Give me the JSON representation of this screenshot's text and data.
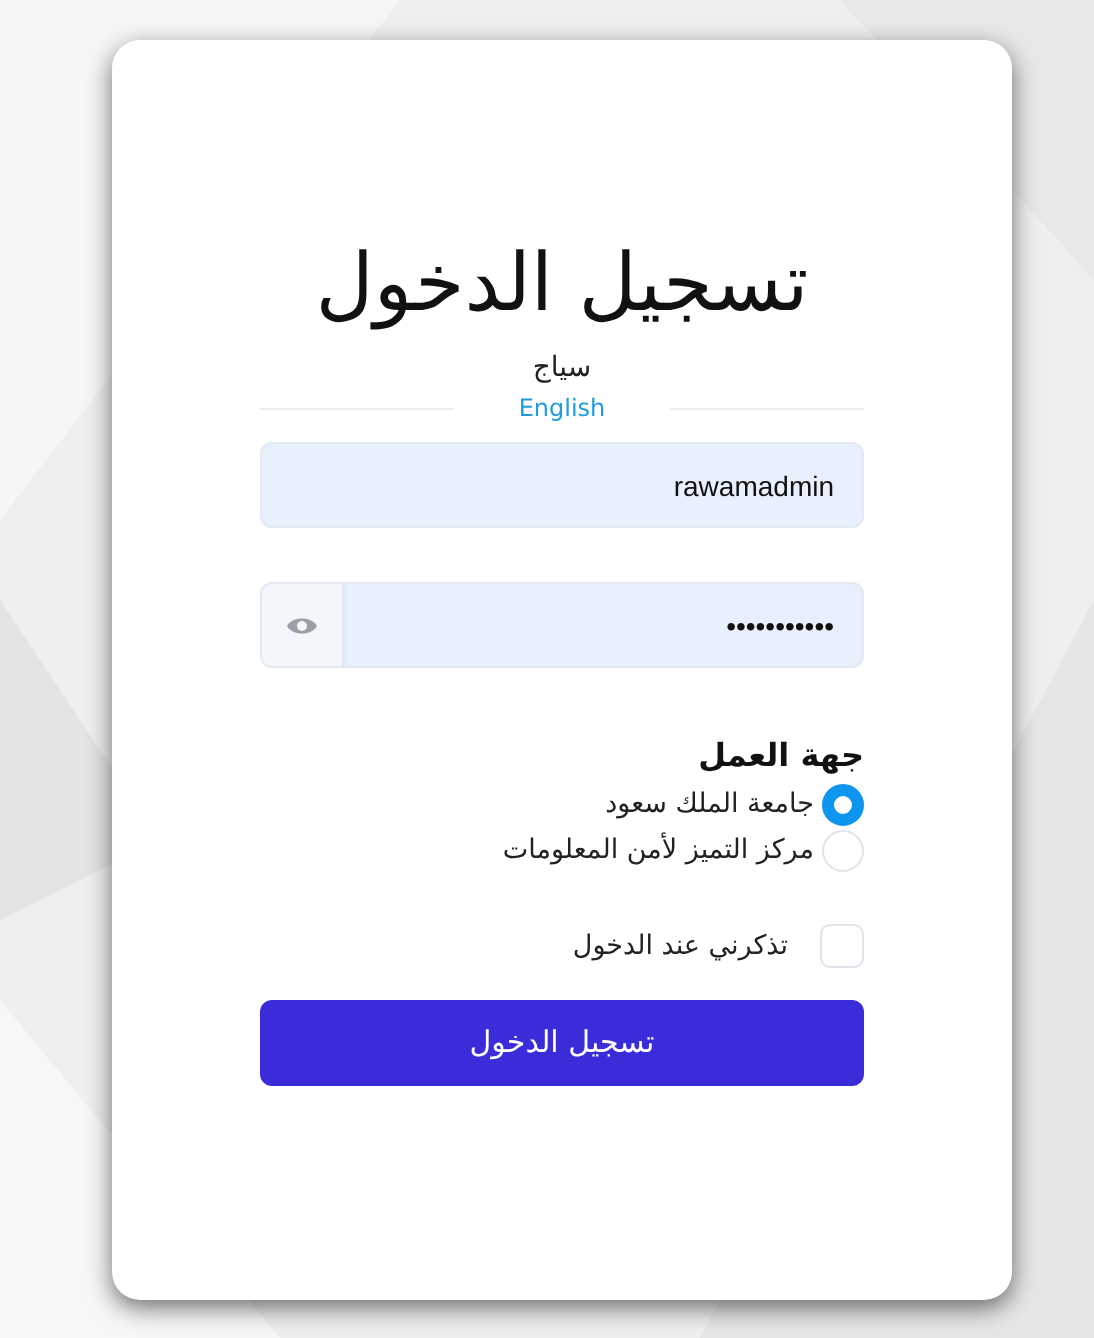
{
  "title": "تسجيل الدخول",
  "subtitle": "سياج",
  "language_link": "English",
  "username": {
    "value": "rawamadmin"
  },
  "password": {
    "value": "•••••••••••"
  },
  "organization": {
    "label": "جهة العمل",
    "options": [
      {
        "label": "جامعة الملك سعود",
        "selected": true
      },
      {
        "label": "مركز التميز لأمن المعلومات",
        "selected": false
      }
    ]
  },
  "remember_me": {
    "label": "تذكرني عند الدخول",
    "checked": false
  },
  "submit_button": "تسجيل الدخول"
}
